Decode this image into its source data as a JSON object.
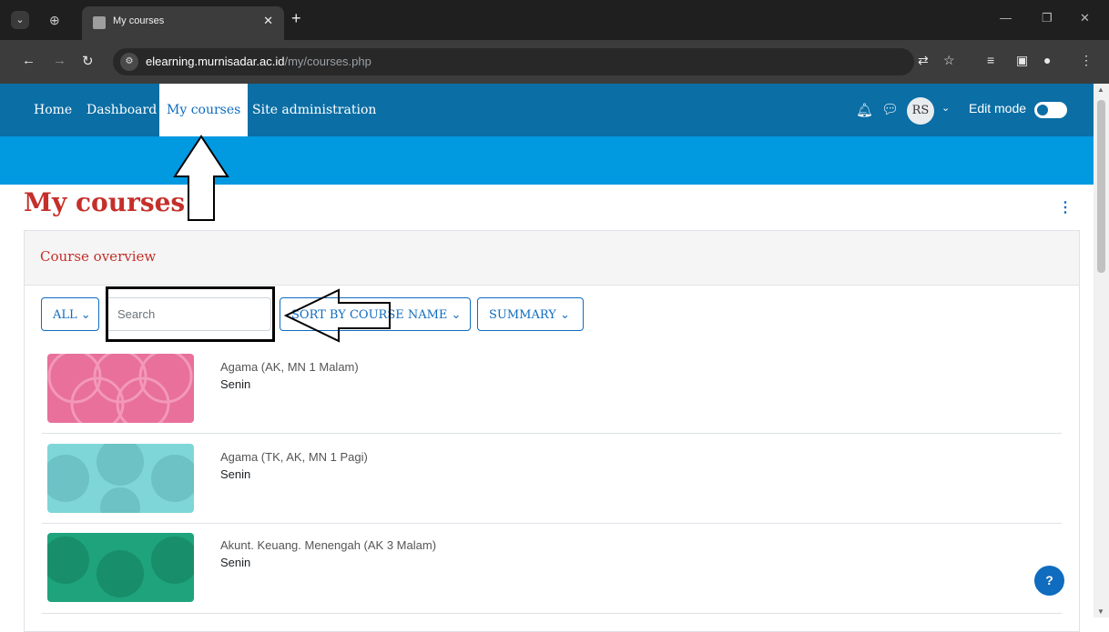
{
  "browser": {
    "tab_title": "My courses",
    "url_host": "elearning.murnisadar.ac.id",
    "url_path": "/my/courses.php"
  },
  "nav": {
    "items": [
      "Home",
      "Dashboard",
      "My courses",
      "Site administration"
    ],
    "active": "My courses",
    "avatar_initials": "RS",
    "edit_mode_label": "Edit mode"
  },
  "page": {
    "title": "My courses",
    "block_title": "Course overview",
    "filter_label": "ALL",
    "search_placeholder": "Search",
    "sort_label": "SORT BY COURSE NAME",
    "view_label": "SUMMARY",
    "help_label": "?"
  },
  "courses": [
    {
      "name": "Agama (AK, MN 1 Malam)",
      "category": "Senin",
      "color": "#e8709a"
    },
    {
      "name": "Agama (TK, AK, MN 1 Pagi)",
      "category": "Senin",
      "color": "#7fd6d8"
    },
    {
      "name": "Akunt. Keuang. Menengah (AK 3 Malam)",
      "category": "Senin",
      "color": "#1ea37d"
    }
  ],
  "colors": {
    "navbar": "#0b6ea5",
    "band": "#0199e0",
    "title_red": "#c52f2a",
    "link_blue": "#0f6cbf"
  }
}
